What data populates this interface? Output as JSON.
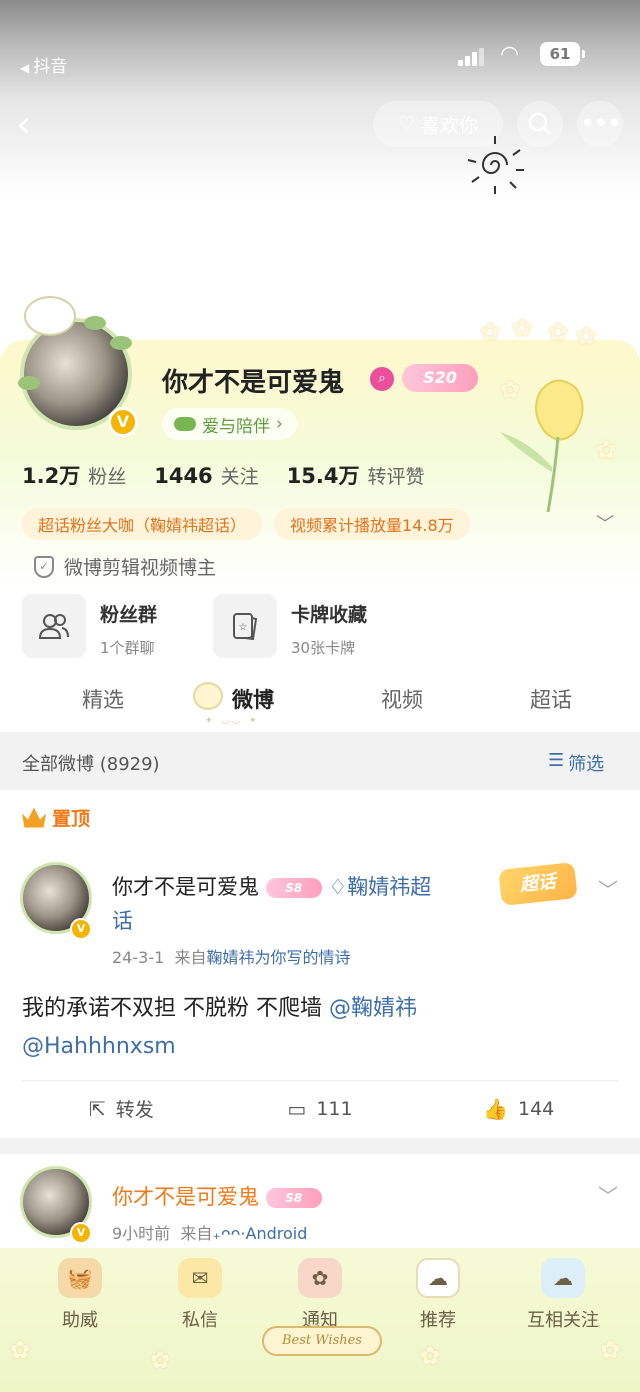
{
  "status_bar": {
    "back_app": "抖音",
    "battery": "61"
  },
  "nav": {
    "like_label": "喜欢你"
  },
  "profile": {
    "name": "你才不是可爱鬼",
    "level_badge": "S20",
    "tag": "爱与陪伴",
    "stats": [
      {
        "value": "1.2万",
        "label": "粉丝"
      },
      {
        "value": "1446",
        "label": "关注"
      },
      {
        "value": "15.4万",
        "label": "转评赞"
      }
    ],
    "chips": [
      "超话粉丝大咖（鞠婧祎超话）",
      "视频累计播放量14.8万"
    ],
    "certification": "微博剪辑视频博主",
    "cards": [
      {
        "title": "粉丝群",
        "sub": "1个群聊"
      },
      {
        "title": "卡牌收藏",
        "sub": "30张卡牌"
      }
    ]
  },
  "tabs": [
    "精选",
    "微博",
    "视频",
    "超话"
  ],
  "filter": {
    "label": "全部微博 (8929)",
    "action": "筛选"
  },
  "pinned_label": "置顶",
  "posts": [
    {
      "name": "你才不是可爱鬼",
      "level": "S8",
      "topic": "鞠婧祎超话",
      "date": "24-3-1",
      "source_prefix": "来自",
      "source": "鞠婧祎为你写的情诗",
      "badge": "超话",
      "text": "我的承诺不双担 不脱粉 不爬墙 ",
      "mention1": "@鞠婧祎",
      "mention2": "@Hahhhnxsm",
      "repost_label": "转发",
      "comments": "111",
      "likes": "144"
    },
    {
      "name": "你才不是可爱鬼",
      "level": "S8",
      "time": "9小时前",
      "source_prefix": "来自",
      "source": "·Android"
    }
  ],
  "bottom_nav": [
    "助威",
    "私信",
    "通知",
    "推荐",
    "互相关注"
  ],
  "bottom_banner": "Best Wishes"
}
